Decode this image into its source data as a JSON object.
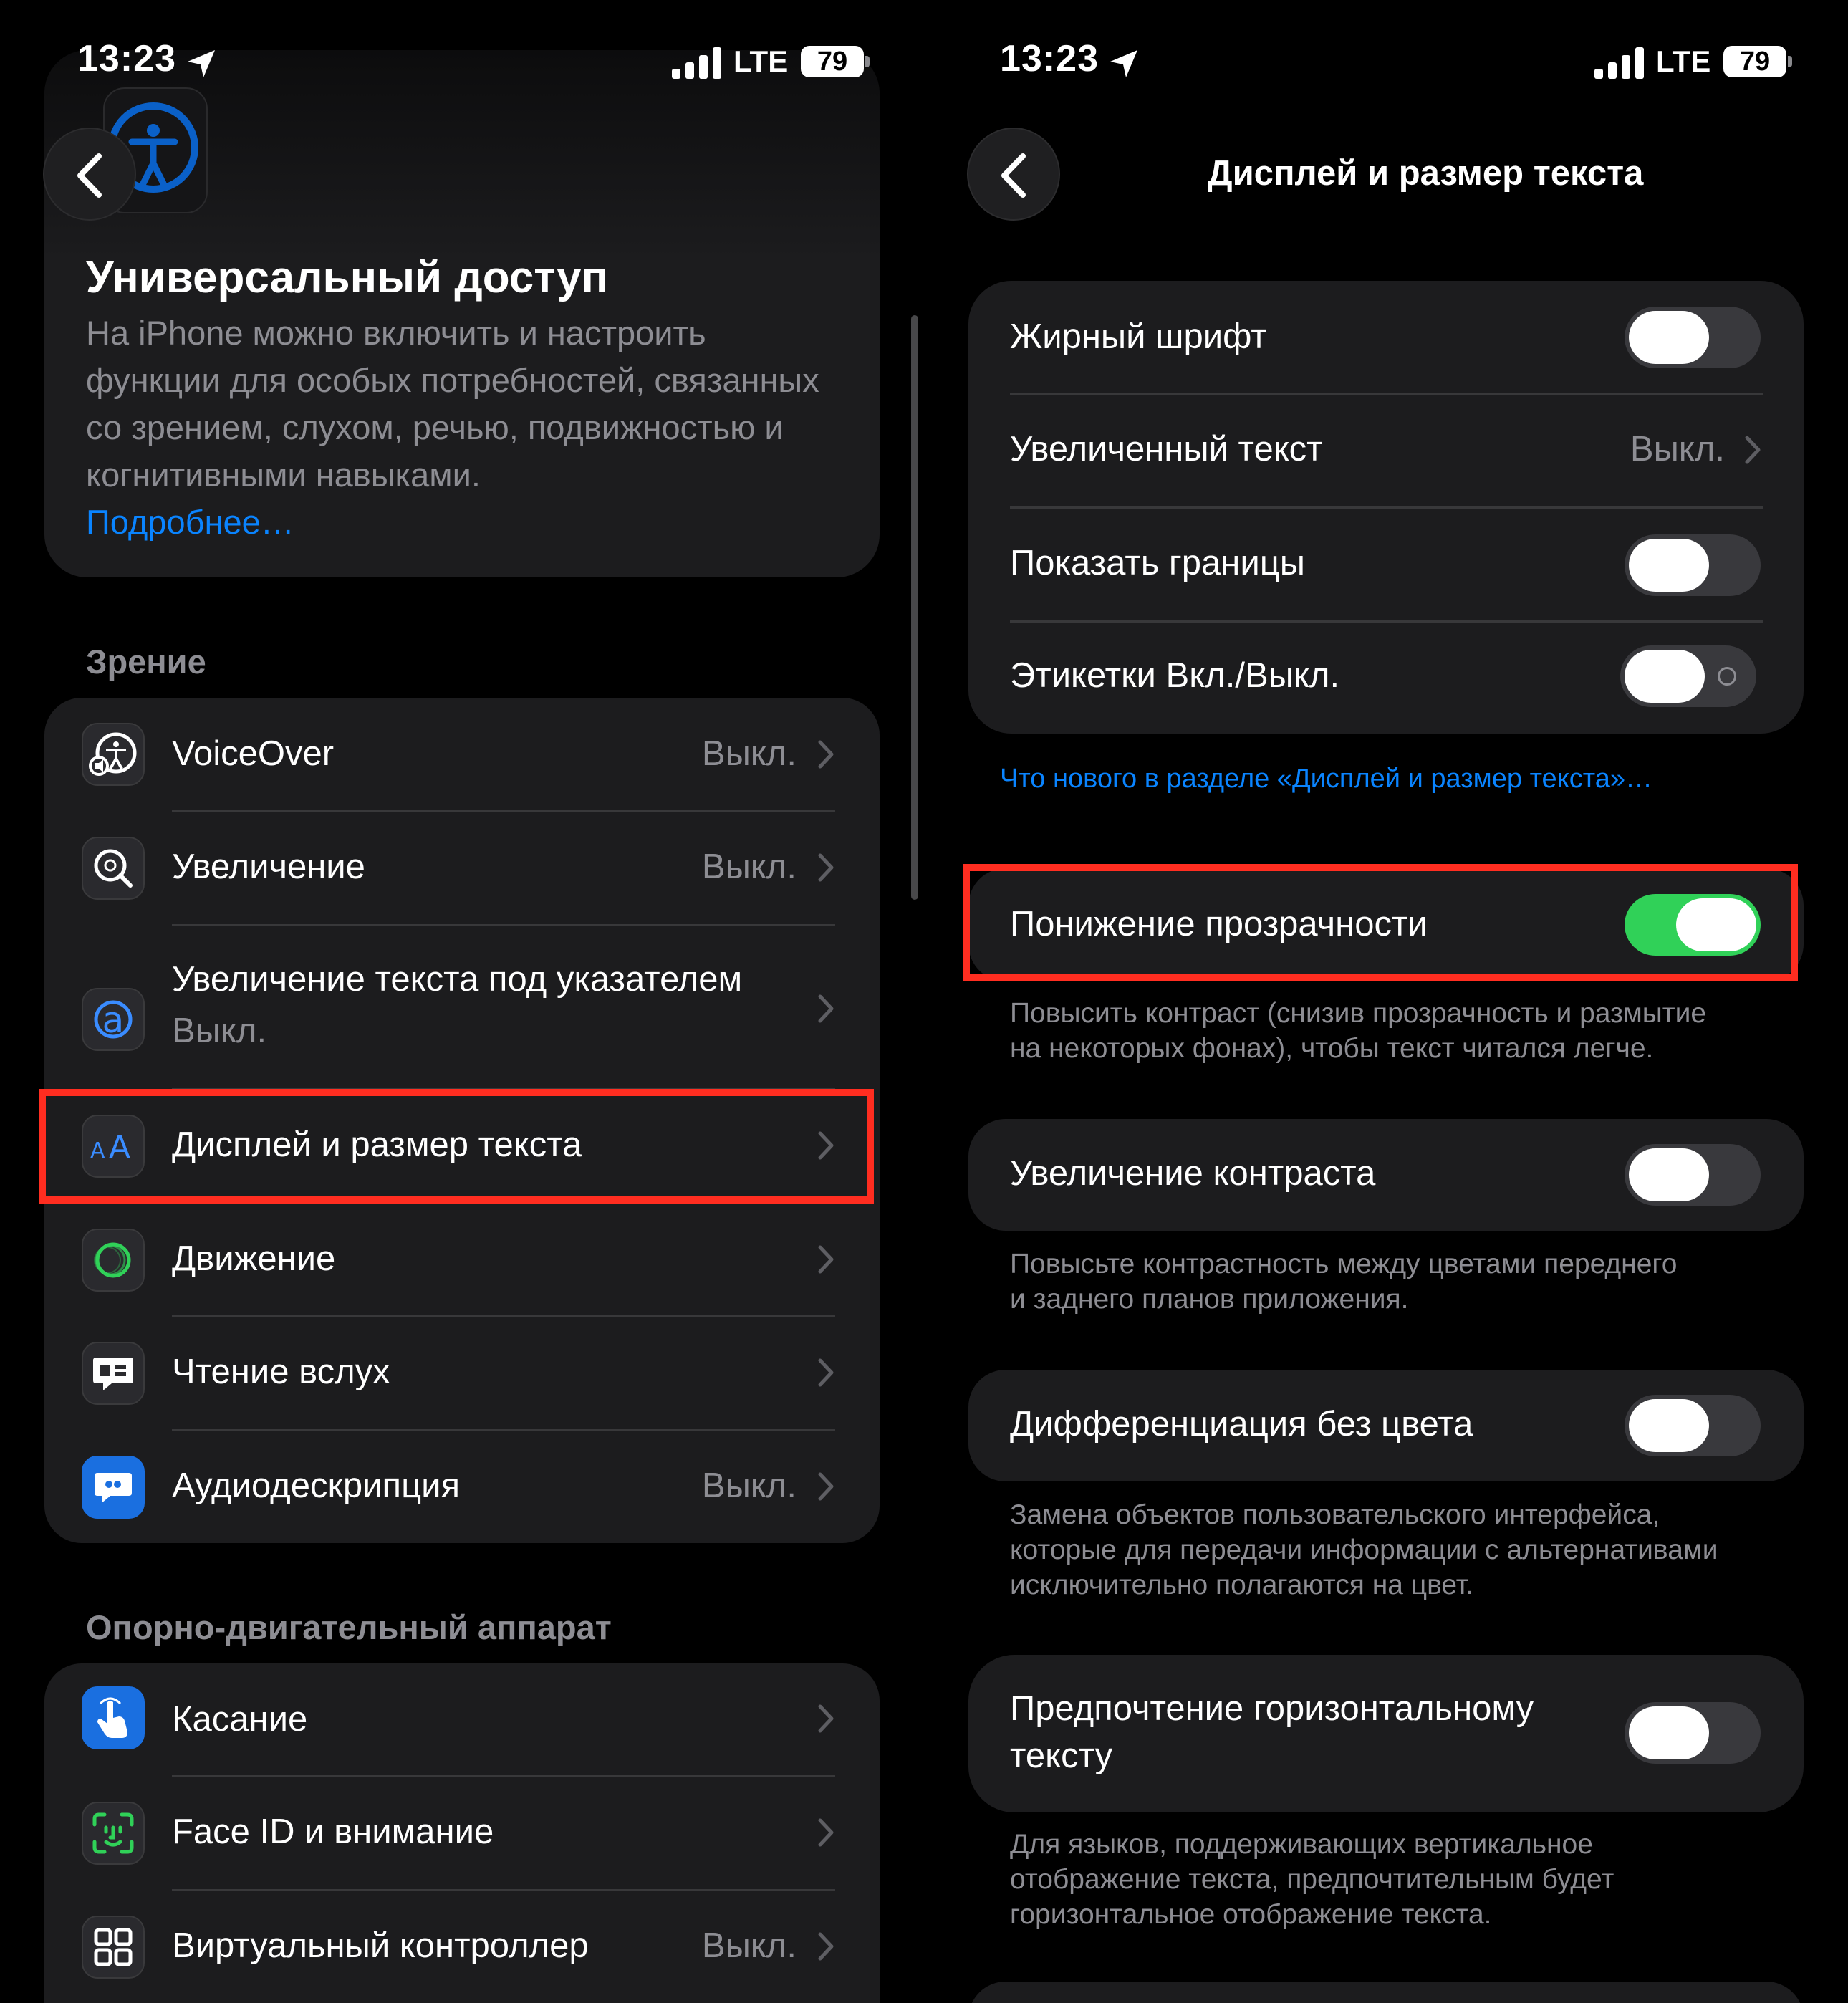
{
  "status_bar": {
    "time": "13:23",
    "network": "LTE",
    "battery": "79"
  },
  "left": {
    "header": {
      "title": "Универсальный доступ",
      "description": "На iPhone можно включить и настроить функции для особых потребностей, связанных со зрением, слухом, речью, подвижностью и когнитивными навыками.",
      "link": "Подробнее…"
    },
    "vision": {
      "section_title": "Зрение",
      "items": [
        {
          "label": "VoiceOver",
          "value": "Выкл.",
          "icon": "voiceover-icon"
        },
        {
          "label": "Увеличение",
          "value": "Выкл.",
          "icon": "zoom-icon"
        },
        {
          "label": "Увеличение текста под указателем",
          "value": "Выкл.",
          "icon": "hover-text-icon"
        },
        {
          "label": "Дисплей и размер текста",
          "value": "",
          "icon": "display-text-size-icon"
        },
        {
          "label": "Движение",
          "value": "",
          "icon": "motion-icon"
        },
        {
          "label": "Чтение вслух",
          "value": "",
          "icon": "spoken-content-icon"
        },
        {
          "label": "Аудиодескрипция",
          "value": "Выкл.",
          "icon": "audio-description-icon"
        }
      ]
    },
    "motor": {
      "section_title": "Опорно-двигательный аппарат",
      "items": [
        {
          "label": "Касание",
          "value": "",
          "icon": "touch-icon"
        },
        {
          "label": "Face ID и внимание",
          "value": "",
          "icon": "face-id-icon"
        },
        {
          "label": "Виртуальный контроллер",
          "value": "Выкл.",
          "icon": "switch-control-icon"
        }
      ]
    }
  },
  "right": {
    "nav_title": "Дисплей и размер текста",
    "group1": {
      "bold_text": {
        "label": "Жирный шрифт",
        "on": false
      },
      "larger_text": {
        "label": "Увеличенный текст",
        "value": "Выкл."
      },
      "button_shapes": {
        "label": "Показать границы",
        "on": false
      },
      "onoff_labels": {
        "label": "Этикетки Вкл./Выкл.",
        "on": false
      }
    },
    "whats_new_link": "Что нового в разделе «Дисплей и размер текста»…",
    "reduce_transparency": {
      "label": "Понижение прозрачности",
      "on": true,
      "footer_line1": "Повысить контраст (снизив прозрачность и размытие",
      "footer_line2": "на некоторых фонах), чтобы текст читался легче."
    },
    "increase_contrast": {
      "label": "Увеличение контраста",
      "on": false,
      "footer_line1": "Повысьте контрастность между цветами переднего",
      "footer_line2": "и заднего планов приложения."
    },
    "differentiate_without_color": {
      "label": "Дифференциация без цвета",
      "on": false,
      "footer_line1": "Замена объектов пользовательского интерфейса,",
      "footer_line2": "которые для передачи информации с альтернативами",
      "footer_line3": "исключительно полагаются на цвет."
    },
    "prefer_horizontal_text": {
      "label_line1": "Предпочтение горизонтальному",
      "label_line2": "тексту",
      "on": false,
      "footer_line1": "Для языков, поддерживающих вертикальное",
      "footer_line2": "отображение текста, предпочтительным будет",
      "footer_line3": "горизонтальное отображение текста."
    }
  },
  "colors": {
    "background": "#000000",
    "card": "#1c1c1e",
    "separator": "#38383a",
    "secondary_text": "#8d8d93",
    "link": "#0a84ff",
    "toggle_on": "#30d158",
    "toggle_off": "#39393d",
    "highlight": "#ff2d20"
  }
}
